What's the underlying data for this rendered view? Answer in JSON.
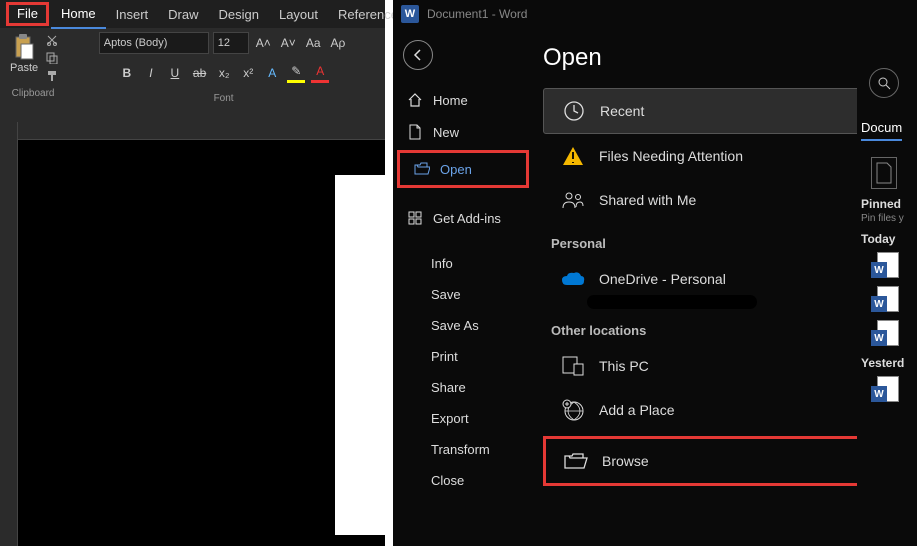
{
  "left": {
    "tabs": {
      "file": "File",
      "home": "Home",
      "insert": "Insert",
      "draw": "Draw",
      "design": "Design",
      "layout": "Layout",
      "references": "References"
    },
    "clipboard": {
      "paste": "Paste",
      "label": "Clipboard"
    },
    "font": {
      "family": "Aptos (Body)",
      "size": "12",
      "grow": "A˄",
      "shrink": "A˅",
      "case": "Aa",
      "clear": "Aρ",
      "bold": "B",
      "italic": "I",
      "underline": "U",
      "strike": "ab",
      "sub": "x₂",
      "sup": "x²",
      "label": "Font"
    }
  },
  "right": {
    "title": "Document1 - Word",
    "nav": {
      "home": "Home",
      "new": "New",
      "open": "Open",
      "addins": "Get Add-ins",
      "info": "Info",
      "save": "Save",
      "saveas": "Save As",
      "print": "Print",
      "share": "Share",
      "export": "Export",
      "transform": "Transform",
      "close": "Close"
    },
    "page_title": "Open",
    "locations": {
      "recent": "Recent",
      "attention": "Files Needing Attention",
      "shared": "Shared with Me",
      "personal_hdr": "Personal",
      "onedrive": "OneDrive - Personal",
      "other_hdr": "Other locations",
      "thispc": "This PC",
      "addplace": "Add a Place",
      "browse": "Browse"
    },
    "rightcol": {
      "docs_tab": "Docum",
      "pinned": "Pinned",
      "pinned_sub": "Pin files y",
      "today": "Today",
      "yesterday": "Yesterd"
    }
  }
}
